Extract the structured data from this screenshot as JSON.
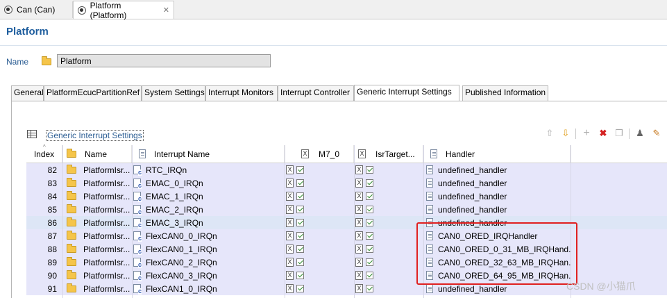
{
  "editor_tabs": [
    {
      "label": "Can (Can)",
      "active": false
    },
    {
      "label": "Platform (Platform)",
      "active": true
    }
  ],
  "page_title": "Platform",
  "name_field": {
    "label": "Name",
    "value": "Platform"
  },
  "tabs": [
    "General",
    "PlatformEcucPartitionRef",
    "System Settings",
    "Interrupt Monitors",
    "Interrupt Controller",
    "Generic Interrupt Settings",
    "Published Information"
  ],
  "section_title": "Generic Interrupt Settings",
  "columns": {
    "index": "Index",
    "name": "Name",
    "interrupt_name": "Interrupt Name",
    "m7_0": "M7_0",
    "isr_target": "IsrTarget...",
    "handler": "Handler"
  },
  "rows": [
    {
      "index": "82",
      "name": "PlatformIsr...",
      "interrupt": "RTC_IRQn",
      "handler": "undefined_handler"
    },
    {
      "index": "83",
      "name": "PlatformIsr...",
      "interrupt": "EMAC_0_IRQn",
      "handler": "undefined_handler"
    },
    {
      "index": "84",
      "name": "PlatformIsr...",
      "interrupt": "EMAC_1_IRQn",
      "handler": "undefined_handler"
    },
    {
      "index": "85",
      "name": "PlatformIsr...",
      "interrupt": "EMAC_2_IRQn",
      "handler": "undefined_handler"
    },
    {
      "index": "86",
      "name": "PlatformIsr...",
      "interrupt": "EMAC_3_IRQn",
      "handler": "undefined_handler"
    },
    {
      "index": "87",
      "name": "PlatformIsr...",
      "interrupt": "FlexCAN0_0_IRQn",
      "handler": "CAN0_ORED_IRQHandler"
    },
    {
      "index": "88",
      "name": "PlatformIsr...",
      "interrupt": "FlexCAN0_1_IRQn",
      "handler": "CAN0_ORED_0_31_MB_IRQHand..."
    },
    {
      "index": "89",
      "name": "PlatformIsr...",
      "interrupt": "FlexCAN0_2_IRQn",
      "handler": "CAN0_ORED_32_63_MB_IRQHan..."
    },
    {
      "index": "90",
      "name": "PlatformIsr...",
      "interrupt": "FlexCAN0_3_IRQn",
      "handler": "CAN0_ORED_64_95_MB_IRQHan..."
    },
    {
      "index": "91",
      "name": "PlatformIsr...",
      "interrupt": "FlexCAN1_0_IRQn",
      "handler": "undefined_handler"
    }
  ],
  "watermark": "CSDN @小猫爪"
}
